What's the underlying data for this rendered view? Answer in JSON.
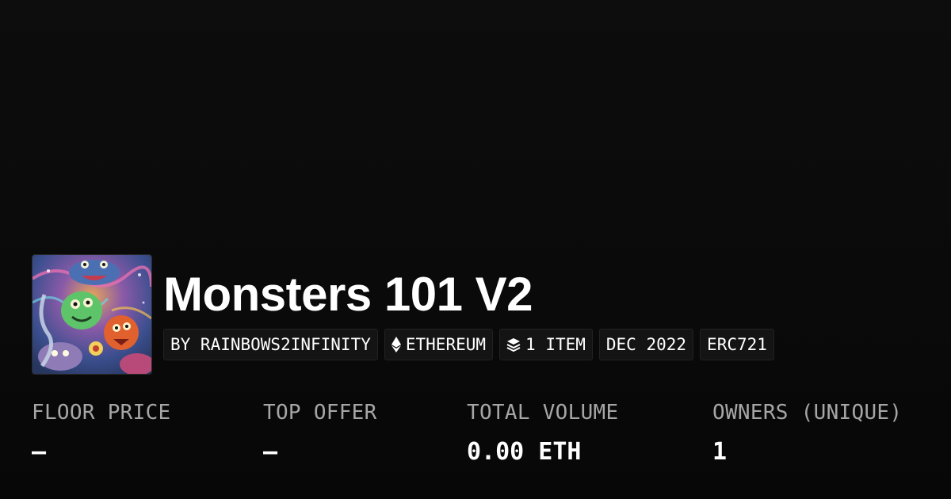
{
  "collection": {
    "title": "Monsters 101 V2",
    "thumbnail_icon": "monster-artwork-image"
  },
  "chips": {
    "creator": "BY RAINBOWS2INFINITY",
    "chain": "ETHEREUM",
    "chain_icon": "ethereum-icon",
    "items": "1 ITEM",
    "items_icon": "layers-icon",
    "date": "DEC 2022",
    "standard": "ERC721"
  },
  "stats": [
    {
      "label": "FLOOR PRICE",
      "value": "–"
    },
    {
      "label": "TOP OFFER",
      "value": "–"
    },
    {
      "label": "TOTAL VOLUME",
      "value": "0.00 ETH"
    },
    {
      "label": "OWNERS (UNIQUE)",
      "value": "1"
    }
  ],
  "colors": {
    "background": "#0b0b0b",
    "chip_background": "#141414",
    "label_gray": "#a6a6a6",
    "text": "#ffffff"
  }
}
